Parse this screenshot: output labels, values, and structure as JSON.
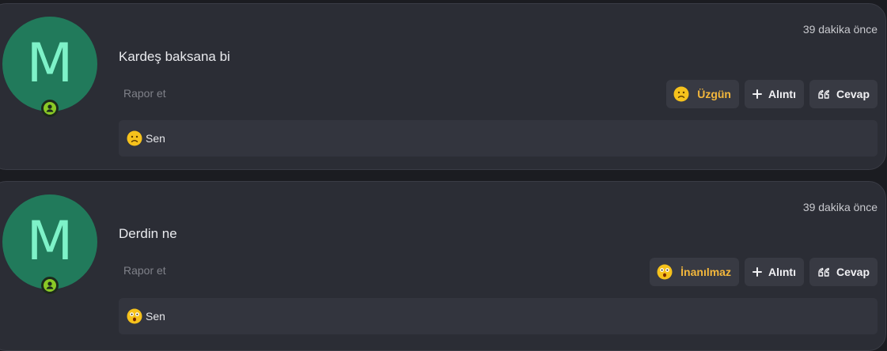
{
  "posts": [
    {
      "avatar_letter": "M",
      "timestamp": "39 dakika önce",
      "message": "Kardeş baksana bi",
      "report_label": "Rapor et",
      "reaction_button": {
        "label": "Üzgün",
        "icon": "sad-face-icon"
      },
      "quote_button": {
        "label": "Alıntı",
        "icon": "plus-icon"
      },
      "reply_button": {
        "label": "Cevap",
        "icon": "quote-marks-icon"
      },
      "reaction_summary": {
        "icon": "sad-face-icon",
        "label": "Sen"
      }
    },
    {
      "avatar_letter": "M",
      "timestamp": "39 dakika önce",
      "message": "Derdin ne",
      "report_label": "Rapor et",
      "reaction_button": {
        "label": "İnanılmaz",
        "icon": "astonished-face-icon"
      },
      "quote_button": {
        "label": "Alıntı",
        "icon": "plus-icon"
      },
      "reply_button": {
        "label": "Cevap",
        "icon": "quote-marks-icon"
      },
      "reaction_summary": {
        "icon": "astonished-face-icon",
        "label": "Sen"
      }
    }
  ],
  "colors": {
    "avatar_bg": "#217a5b",
    "avatar_letter": "#7ef2c8",
    "reaction_text": "#f3b73c",
    "online_status": "#8ac926"
  }
}
